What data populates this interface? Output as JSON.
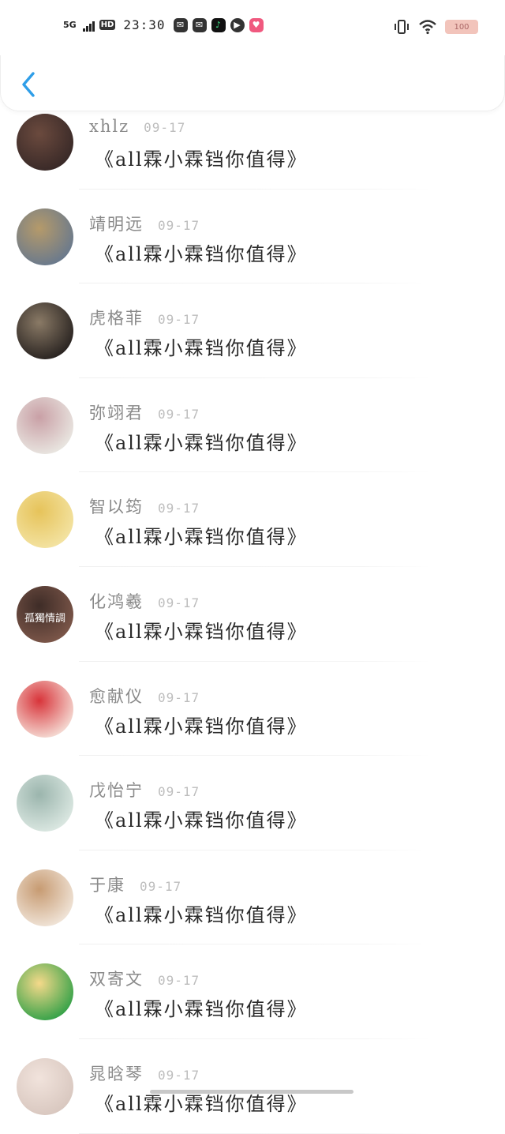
{
  "status_bar": {
    "network": "5G",
    "hd": "HD",
    "time": "23:30",
    "battery": "100"
  },
  "header": {
    "back_icon": "chevron-left-icon",
    "accent_color": "#2f9ee8"
  },
  "comments": [
    {
      "name": "xhlz",
      "date": "09-17",
      "text": "《all霖小霖铛你值得》",
      "avatar_colors": [
        "#3a2a28",
        "#6b4a3e"
      ],
      "avatar_label": ""
    },
    {
      "name": "靖明远",
      "date": "09-17",
      "text": "《all霖小霖铛你值得》",
      "avatar_colors": [
        "#6b7a8c",
        "#b59a6a"
      ],
      "avatar_label": ""
    },
    {
      "name": "虎格菲",
      "date": "09-17",
      "text": "《all霖小霖铛你值得》",
      "avatar_colors": [
        "#2b2522",
        "#8a7a66"
      ],
      "avatar_label": ""
    },
    {
      "name": "弥翊君",
      "date": "09-17",
      "text": "《all霖小霖铛你值得》",
      "avatar_colors": [
        "#e8e4df",
        "#c9a0a6"
      ],
      "avatar_label": ""
    },
    {
      "name": "智以筠",
      "date": "09-17",
      "text": "《all霖小霖铛你值得》",
      "avatar_colors": [
        "#f3e2a0",
        "#e6c35a"
      ],
      "avatar_label": ""
    },
    {
      "name": "化鸿羲",
      "date": "09-17",
      "text": "《all霖小霖铛你值得》",
      "avatar_colors": [
        "#7a5548",
        "#3e2c27"
      ],
      "avatar_label": "孤獨情調"
    },
    {
      "name": "愈献仪",
      "date": "09-17",
      "text": "《all霖小霖铛你值得》",
      "avatar_colors": [
        "#f4d6cf",
        "#d8343a"
      ],
      "avatar_label": ""
    },
    {
      "name": "戊怡宁",
      "date": "09-17",
      "text": "《all霖小霖铛你值得》",
      "avatar_colors": [
        "#d9e6e0",
        "#9bb5ad"
      ],
      "avatar_label": ""
    },
    {
      "name": "于康",
      "date": "09-17",
      "text": "《all霖小霖铛你值得》",
      "avatar_colors": [
        "#efe2d5",
        "#c79b72"
      ],
      "avatar_label": ""
    },
    {
      "name": "双寄文",
      "date": "09-17",
      "text": "《all霖小霖铛你值得》",
      "avatar_colors": [
        "#3aa34a",
        "#f5d98a"
      ],
      "avatar_label": ""
    },
    {
      "name": "晁晗琴",
      "date": "09-17",
      "text": "《all霖小霖铛你值得》",
      "avatar_colors": [
        "#d9c8c0",
        "#f1e3dc"
      ],
      "avatar_label": ""
    }
  ]
}
